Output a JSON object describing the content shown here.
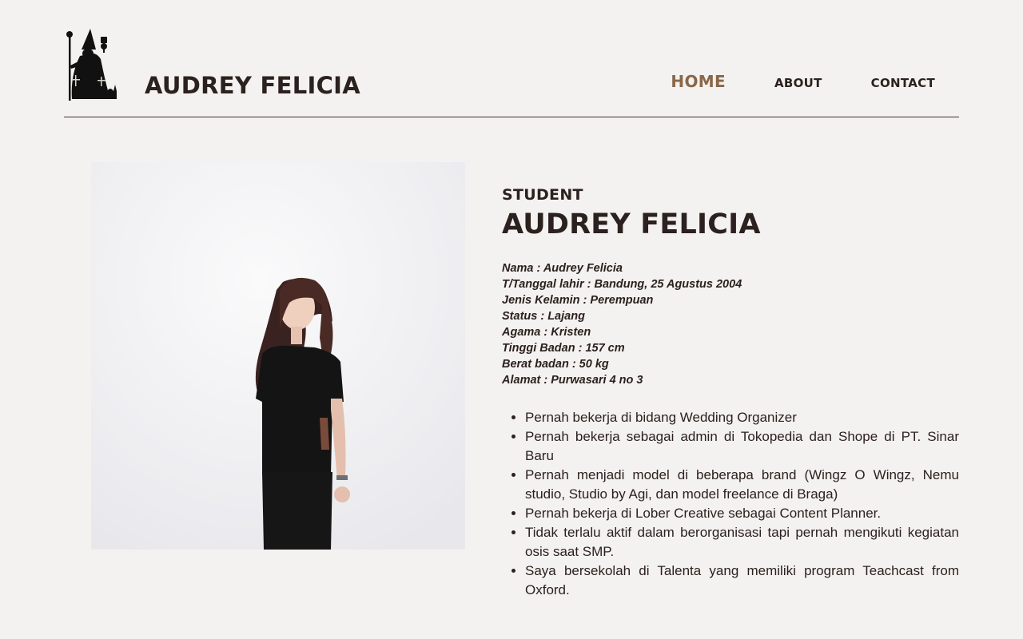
{
  "header": {
    "site_name": "AUDREY FELICIA",
    "logo_icon": "wizard-silhouette-icon",
    "nav": [
      {
        "label": "HOME",
        "active": true
      },
      {
        "label": "ABOUT",
        "active": false
      },
      {
        "label": "CONTACT",
        "active": false
      }
    ]
  },
  "profile": {
    "role": "STUDENT",
    "name": "AUDREY FELICIA",
    "details": [
      "Nama : Audrey Felicia",
      "T/Tanggal lahir : Bandung, 25 Agustus 2004",
      "Jenis Kelamin : Perempuan",
      "Status : Lajang",
      "Agama : Kristen",
      "Tinggi Badan : 157 cm",
      "Berat badan : 50 kg",
      "Alamat : Purwasari 4 no 3"
    ],
    "experience": [
      "Pernah bekerja di bidang Wedding Organizer",
      "Pernah bekerja sebagai admin di Tokopedia dan Shope di PT. Sinar Baru",
      "Pernah menjadi model di beberapa brand (Wingz O Wingz, Nemu studio, Studio by Agi, dan model freelance di Braga)",
      "Pernah bekerja di Lober Creative sebagai Content Planner.",
      "Tidak terlalu aktif dalam berorganisasi tapi pernah mengikuti kegiatan osis saat SMP.",
      "Saya bersekolah di Talenta yang memiliki program Teachcast from Oxford."
    ]
  },
  "colors": {
    "background": "#f4f2f0",
    "text": "#2b211e",
    "accent": "#8a6749"
  }
}
